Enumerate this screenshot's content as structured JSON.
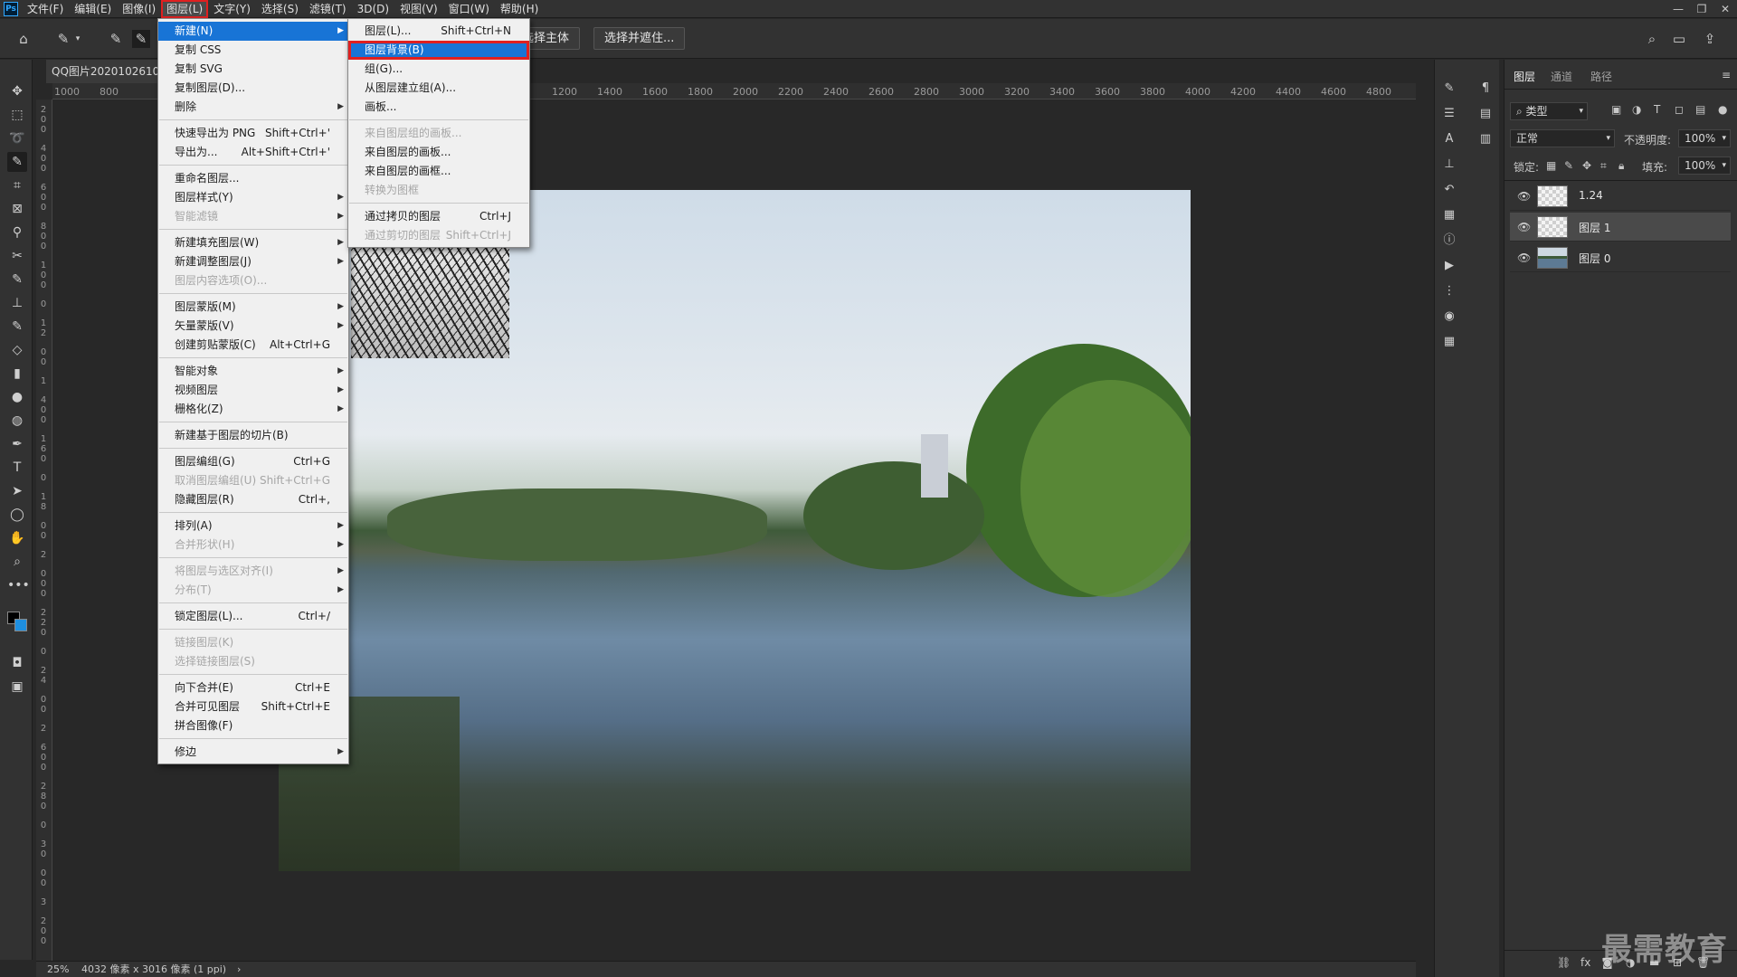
{
  "menubar": {
    "items": [
      "文件(F)",
      "编辑(E)",
      "图像(I)",
      "图层(L)",
      "文字(Y)",
      "选择(S)",
      "滤镜(T)",
      "3D(D)",
      "视图(V)",
      "窗口(W)",
      "帮助(H)"
    ]
  },
  "optionsbar": {
    "select_subject": "选择主体",
    "select_and_mask": "选择并遮住..."
  },
  "document": {
    "tab_title": "QQ图片20201026102"
  },
  "rulers": {
    "top": [
      "1000",
      "800",
      "1200",
      "1400",
      "1600",
      "1800",
      "2000",
      "2200",
      "2400",
      "2600",
      "2800",
      "3000",
      "3200",
      "3400",
      "3600",
      "3800",
      "4000",
      "4200",
      "4400",
      "4600",
      "4800"
    ]
  },
  "status": {
    "zoom": "25%",
    "info": "4032 像素 x 3016 像素 (1 ppi)"
  },
  "layer_menu": {
    "items": [
      {
        "label": "新建(N)",
        "submenu": true,
        "highlight": true
      },
      {
        "label": "复制 CSS"
      },
      {
        "label": "复制 SVG"
      },
      {
        "label": "复制图层(D)..."
      },
      {
        "label": "删除",
        "submenu": true
      },
      {
        "label": "快速导出为 PNG",
        "shortcut": "Shift+Ctrl+'"
      },
      {
        "label": "导出为...",
        "shortcut": "Alt+Shift+Ctrl+'"
      },
      {
        "label": "重命名图层..."
      },
      {
        "label": "图层样式(Y)",
        "submenu": true
      },
      {
        "label": "智能滤镜",
        "submenu": true,
        "disabled": true
      },
      {
        "label": "新建填充图层(W)",
        "submenu": true
      },
      {
        "label": "新建调整图层(J)",
        "submenu": true
      },
      {
        "label": "图层内容选项(O)...",
        "disabled": true
      },
      {
        "label": "图层蒙版(M)",
        "submenu": true
      },
      {
        "label": "矢量蒙版(V)",
        "submenu": true
      },
      {
        "label": "创建剪贴蒙版(C)",
        "shortcut": "Alt+Ctrl+G"
      },
      {
        "label": "智能对象",
        "submenu": true
      },
      {
        "label": "视频图层",
        "submenu": true
      },
      {
        "label": "栅格化(Z)",
        "submenu": true
      },
      {
        "label": "新建基于图层的切片(B)"
      },
      {
        "label": "图层编组(G)",
        "shortcut": "Ctrl+G"
      },
      {
        "label": "取消图层编组(U)",
        "shortcut": "Shift+Ctrl+G",
        "disabled": true
      },
      {
        "label": "隐藏图层(R)",
        "shortcut": "Ctrl+,"
      },
      {
        "label": "排列(A)",
        "submenu": true
      },
      {
        "label": "合并形状(H)",
        "submenu": true,
        "disabled": true
      },
      {
        "label": "将图层与选区对齐(I)",
        "submenu": true,
        "disabled": true
      },
      {
        "label": "分布(T)",
        "submenu": true,
        "disabled": true
      },
      {
        "label": "锁定图层(L)...",
        "shortcut": "Ctrl+/"
      },
      {
        "label": "链接图层(K)",
        "disabled": true
      },
      {
        "label": "选择链接图层(S)",
        "disabled": true
      },
      {
        "label": "向下合并(E)",
        "shortcut": "Ctrl+E"
      },
      {
        "label": "合并可见图层",
        "shortcut": "Shift+Ctrl+E"
      },
      {
        "label": "拼合图像(F)"
      },
      {
        "label": "修边",
        "submenu": true
      }
    ]
  },
  "new_submenu": {
    "items": [
      {
        "label": "图层(L)...",
        "shortcut": "Shift+Ctrl+N"
      },
      {
        "label": "图层背景(B)",
        "highlight": true
      },
      {
        "label": "组(G)..."
      },
      {
        "label": "从图层建立组(A)..."
      },
      {
        "label": "画板..."
      },
      {
        "label": "来自图层组的画板...",
        "disabled": true
      },
      {
        "label": "来自图层的画板..."
      },
      {
        "label": "来自图层的画框..."
      },
      {
        "label": "转换为图框",
        "disabled": true
      },
      {
        "label": "通过拷贝的图层",
        "shortcut": "Ctrl+J"
      },
      {
        "label": "通过剪切的图层",
        "shortcut": "Shift+Ctrl+J",
        "disabled": true
      }
    ]
  },
  "layers_panel": {
    "tabs": [
      "图层",
      "通道",
      "路径"
    ],
    "filter": "类型",
    "blend_mode": "正常",
    "opacity_label": "不透明度:",
    "opacity_value": "100%",
    "lock_label": "锁定:",
    "fill_label": "填充:",
    "fill_value": "100%",
    "layers": [
      {
        "name": "1.24",
        "selected": false
      },
      {
        "name": "图层 1",
        "selected": true
      },
      {
        "name": "图层 0",
        "selected": false
      }
    ]
  },
  "watermark": "最需教育",
  "colors": {
    "highlight": "#1874d6",
    "red_box": "#e02020",
    "panel_bg": "#323232",
    "canvas_bg": "#282828"
  }
}
